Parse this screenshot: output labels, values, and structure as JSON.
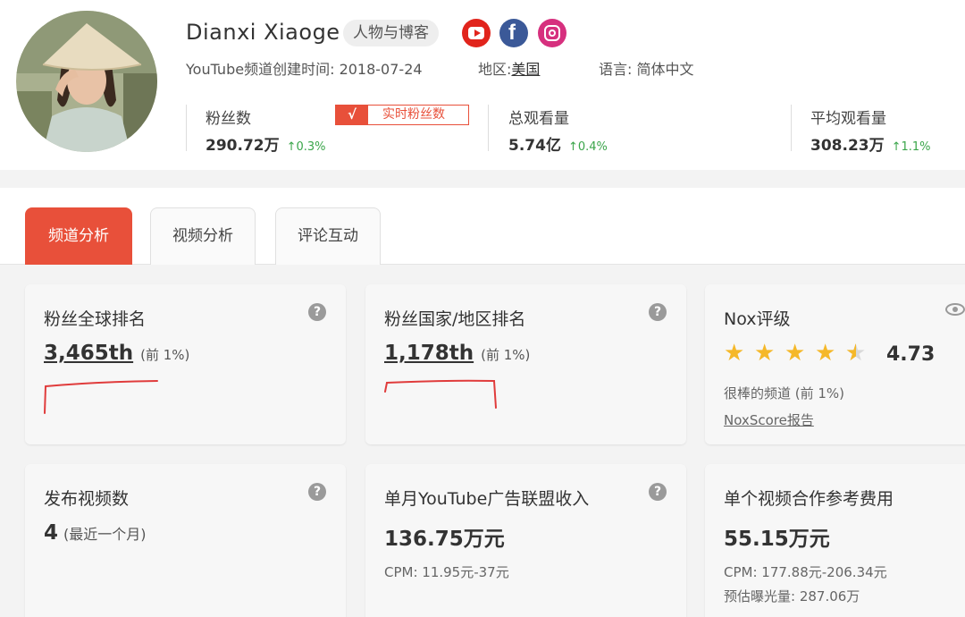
{
  "channel": {
    "name": "Dianxi Xiaoge",
    "category": "人物与博客",
    "meta": {
      "created_label": "YouTube频道创建时间:",
      "created_date": "2018-07-24",
      "region_label": "地区:",
      "region": "美国",
      "language_label": "语言:",
      "language": "简体中文"
    },
    "socials": [
      "youtube-icon",
      "facebook-icon",
      "instagram-icon"
    ]
  },
  "stats": {
    "subscribers": {
      "label": "粉丝数",
      "value": "290.72万",
      "change": "↑0.3%"
    },
    "realtime_button": "实时粉丝数",
    "total_views": {
      "label": "总观看量",
      "value": "5.74亿",
      "change": "↑0.4%"
    },
    "avg_views": {
      "label": "平均观看量",
      "value": "308.23万",
      "change": "↑1.1%"
    }
  },
  "tabs": [
    {
      "label": "频道分析",
      "active": true
    },
    {
      "label": "视频分析",
      "active": false
    },
    {
      "label": "评论互动",
      "active": false
    }
  ],
  "cards": {
    "global_rank": {
      "title": "粉丝全球排名",
      "value": "3,465th",
      "note": "(前 1%)"
    },
    "country_rank": {
      "title": "粉丝国家/地区排名",
      "value": "1,178th",
      "note": "(前 1%)"
    },
    "nox": {
      "title": "Nox评级",
      "rating": 4.73,
      "score_text": "4.73",
      "desc": "很棒的频道 (前 1%)",
      "report_link": "NoxScore报告"
    },
    "videos": {
      "title": "发布视频数",
      "value": "4",
      "note": "(最近一个月)"
    },
    "adsense": {
      "title": "单月YouTube广告联盟收入",
      "value": "136.75万元",
      "cpm": "CPM: 11.95元-37元"
    },
    "collab": {
      "title": "单个视频合作参考费用",
      "value": "55.15万元",
      "cpm": "CPM: 177.88元-206.34元",
      "exposure": "预估曝光量: 287.06万"
    }
  },
  "colors": {
    "accent": "#e8503a",
    "up": "#3aa54a",
    "star": "#f5b829"
  }
}
